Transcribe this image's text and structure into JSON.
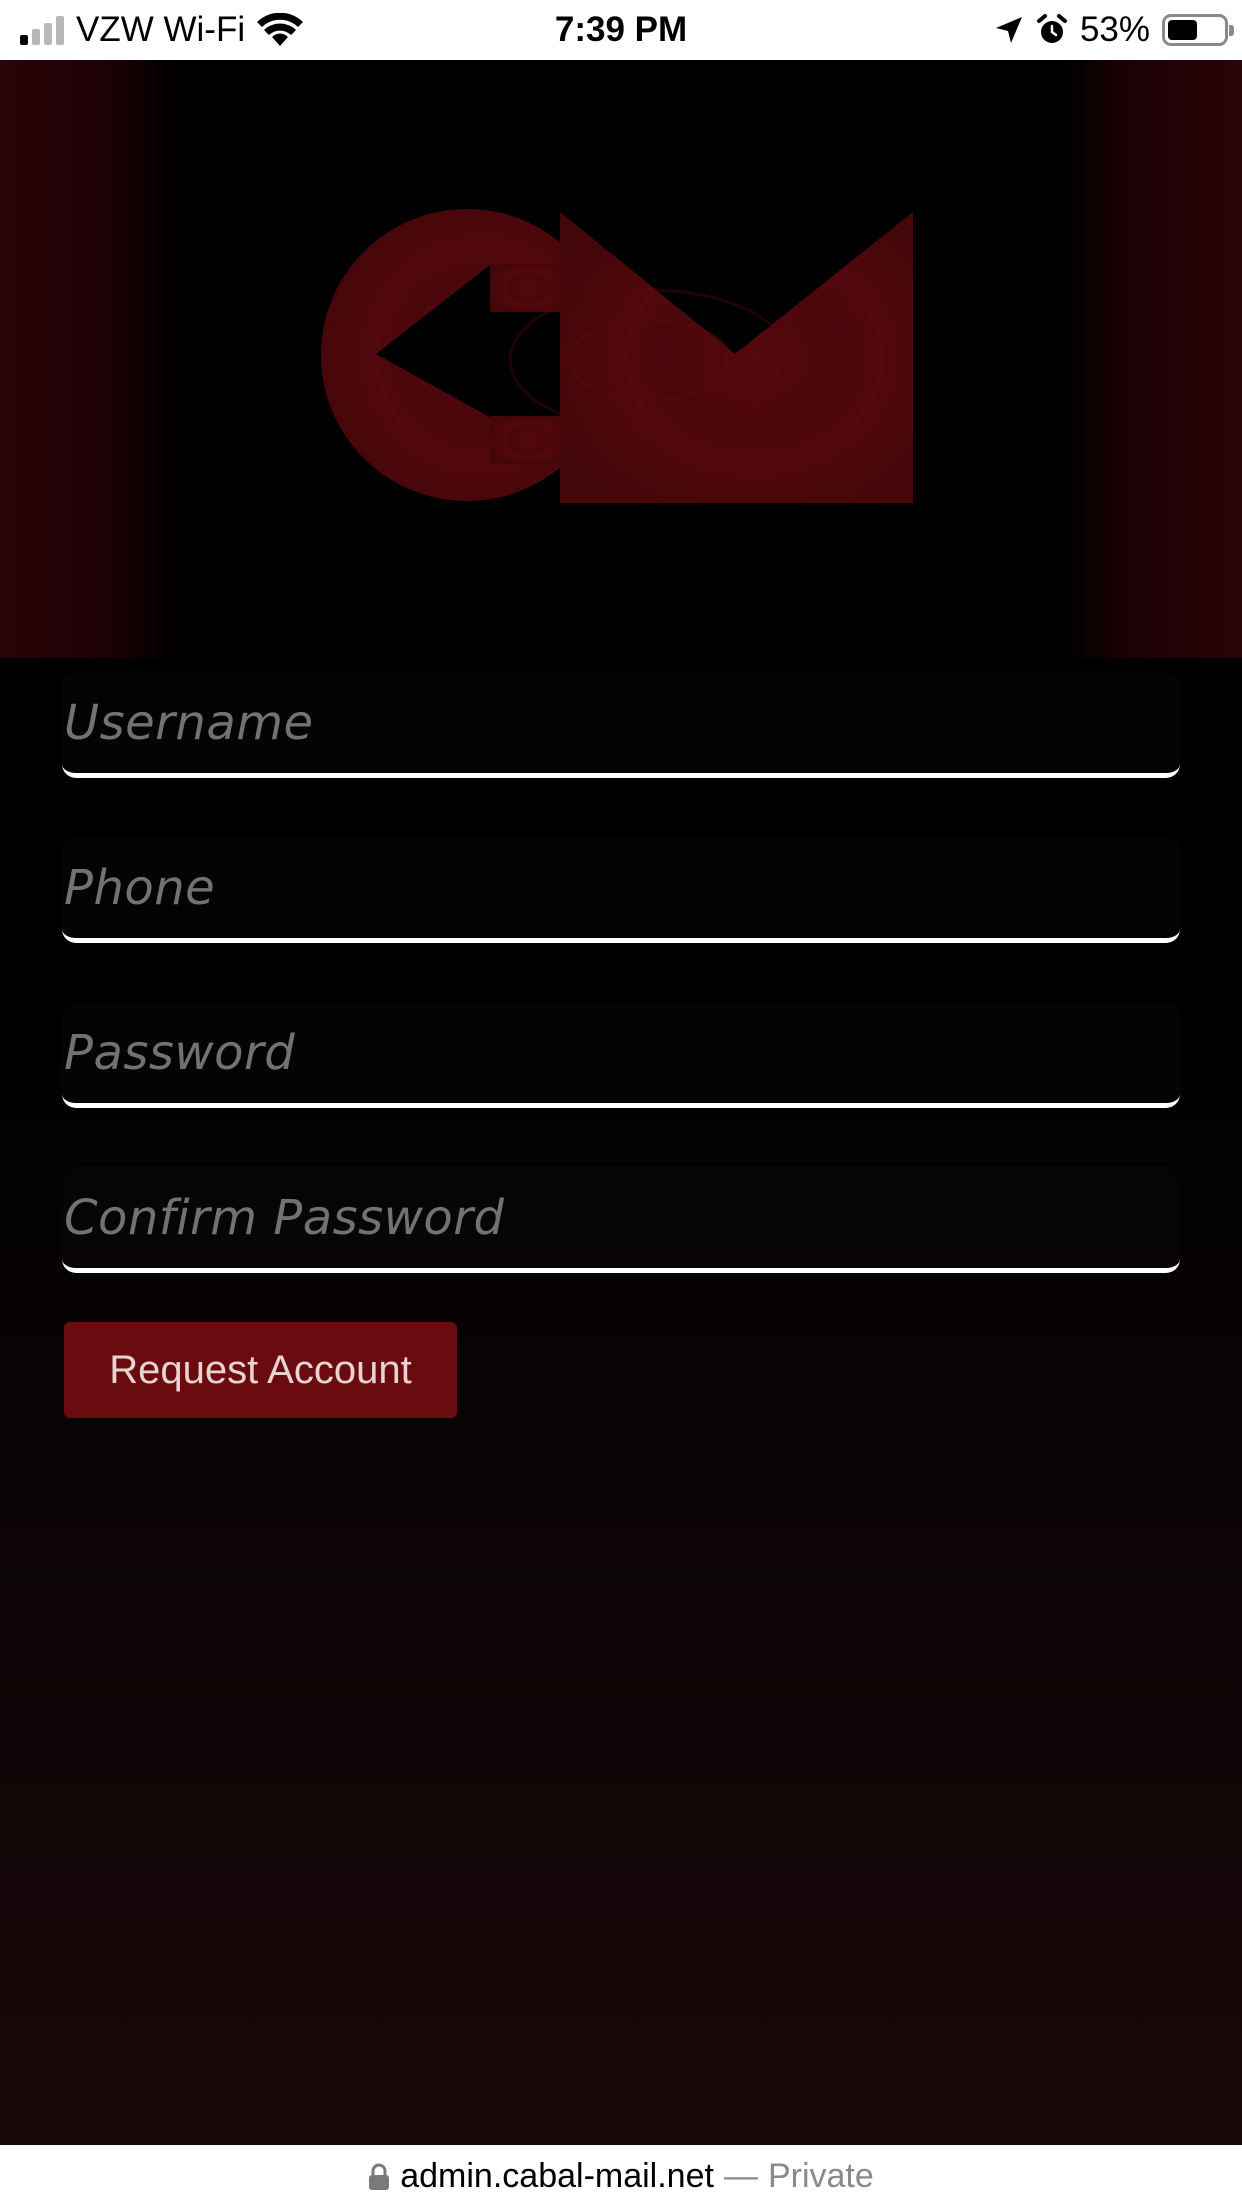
{
  "status_bar": {
    "carrier": "VZW Wi-Fi",
    "time": "7:39 PM",
    "battery_percent": "53%",
    "battery_level": 0.53,
    "icons": [
      "signal-icon",
      "wifi-icon",
      "location-icon",
      "alarm-icon",
      "battery-icon"
    ]
  },
  "form": {
    "username": {
      "placeholder": "Username",
      "value": ""
    },
    "phone": {
      "placeholder": "Phone",
      "value": ""
    },
    "password": {
      "placeholder": "Password",
      "value": ""
    },
    "confirm_password": {
      "placeholder": "Confirm Password",
      "value": ""
    },
    "submit_label": "Request Account"
  },
  "url_bar": {
    "domain": "admin.cabal-mail.net",
    "separator": "—",
    "mode": "Private"
  },
  "colors": {
    "logo": "#4a070b",
    "button": "#6a0b0f",
    "underline": "#ffffff"
  }
}
